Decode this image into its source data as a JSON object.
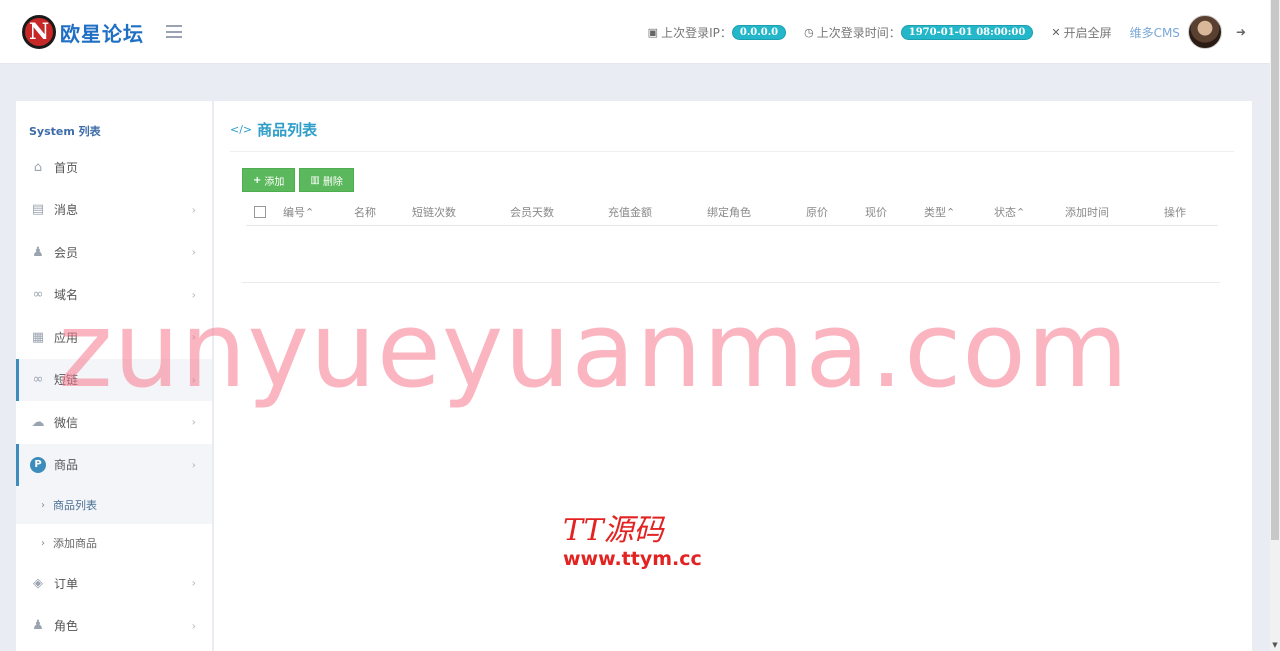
{
  "header": {
    "logo_mark": "N",
    "logo_text": "欧星论坛",
    "last_ip_label": "上次登录IP：",
    "last_ip_value": "0.0.0.0",
    "last_time_label": "上次登录时间：",
    "last_time_value": "1970-01-01 08:00:00",
    "fullscreen_label": "开启全屏",
    "user_name": "维多CMS"
  },
  "sidebar": {
    "title": "System 列表",
    "items": [
      {
        "label": "首页"
      },
      {
        "label": "消息"
      },
      {
        "label": "会员"
      },
      {
        "label": "域名"
      },
      {
        "label": "应用"
      },
      {
        "label": "短链"
      },
      {
        "label": "微信"
      },
      {
        "label": "商品"
      },
      {
        "label": "订单"
      },
      {
        "label": "角色"
      }
    ],
    "subitems": [
      {
        "label": "商品列表"
      },
      {
        "label": "添加商品"
      }
    ]
  },
  "main": {
    "title": "商品列表",
    "add_label": "添加",
    "delete_label": "删除",
    "columns": [
      "编号",
      "名称",
      "短链次数",
      "会员天数",
      "充值金额",
      "绑定角色",
      "原价",
      "现价",
      "类型",
      "状态",
      "添加时间",
      "操作"
    ]
  },
  "watermark": {
    "main": "zunyueyuanma.com",
    "logo_top": "TT源码",
    "logo_bottom": "www.ttym.cc"
  },
  "colors": {
    "accent": "#3c8dbc",
    "title": "#2e9ec9",
    "button_green": "#5cb85c",
    "badge": "#23b7c9"
  }
}
